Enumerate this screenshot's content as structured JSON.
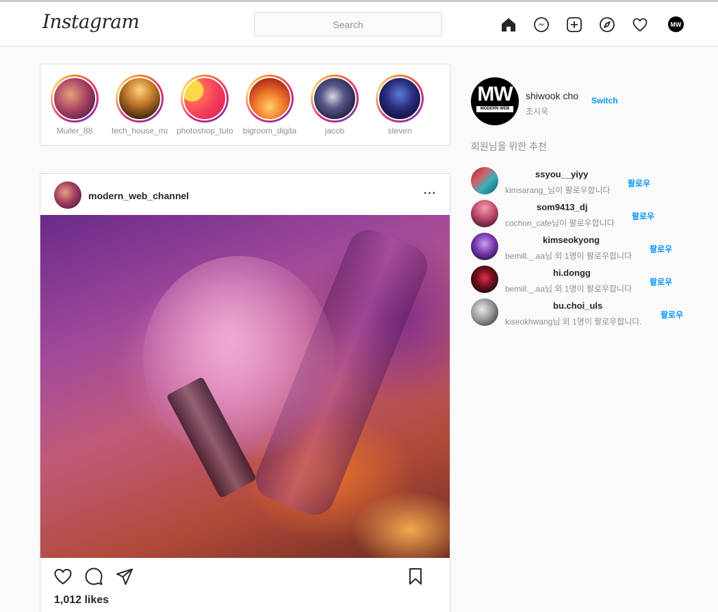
{
  "header": {
    "logo": "Instagram",
    "search_placeholder": "Search",
    "profile_initials": "MW"
  },
  "stories": [
    {
      "name": "Muiler_88"
    },
    {
      "name": "tech_house_ma"
    },
    {
      "name": "photoshop_tuto"
    },
    {
      "name": "bigroom_digita"
    },
    {
      "name": "jacob"
    },
    {
      "name": "steven"
    }
  ],
  "post": {
    "username": "modern_web_channel",
    "more": "···",
    "likes": "1,012 likes"
  },
  "profile": {
    "avatar_text": "MW",
    "avatar_subtext": "MODERN WEB",
    "username": "shiwook cho",
    "name": "조시욱",
    "switch_label": "Switch"
  },
  "suggestions": {
    "title": "회원님을 위한 추천",
    "items": [
      {
        "username": "ssyou__yiyy",
        "desc": "kimsarang_님이 팔로우합니다",
        "follow": "팔로우"
      },
      {
        "username": "som9413_dj",
        "desc": "cochon_cafe님이 팔로우합니다",
        "follow": "팔로우"
      },
      {
        "username": "kimseokyong",
        "desc": "bemill._.aa님 외 1명이 팔로우합니다",
        "follow": "팔로우"
      },
      {
        "username": "hi.dongg",
        "desc": "bemill._.aa님 외 1명이 팔로우합니다",
        "follow": "팔로우"
      },
      {
        "username": "bu.choi_uls",
        "desc": "kiseokhwang님 외 1명이 팔로우합니다.",
        "follow": "팔로우"
      }
    ]
  },
  "colors": {
    "link_blue": "#0095f6",
    "border": "#dbdbdb",
    "background": "#fafafa"
  },
  "icons": [
    "home-icon",
    "messenger-icon",
    "new-post-icon",
    "explore-icon",
    "activity-heart-icon",
    "like-heart-icon",
    "comment-icon",
    "share-icon",
    "bookmark-icon"
  ]
}
